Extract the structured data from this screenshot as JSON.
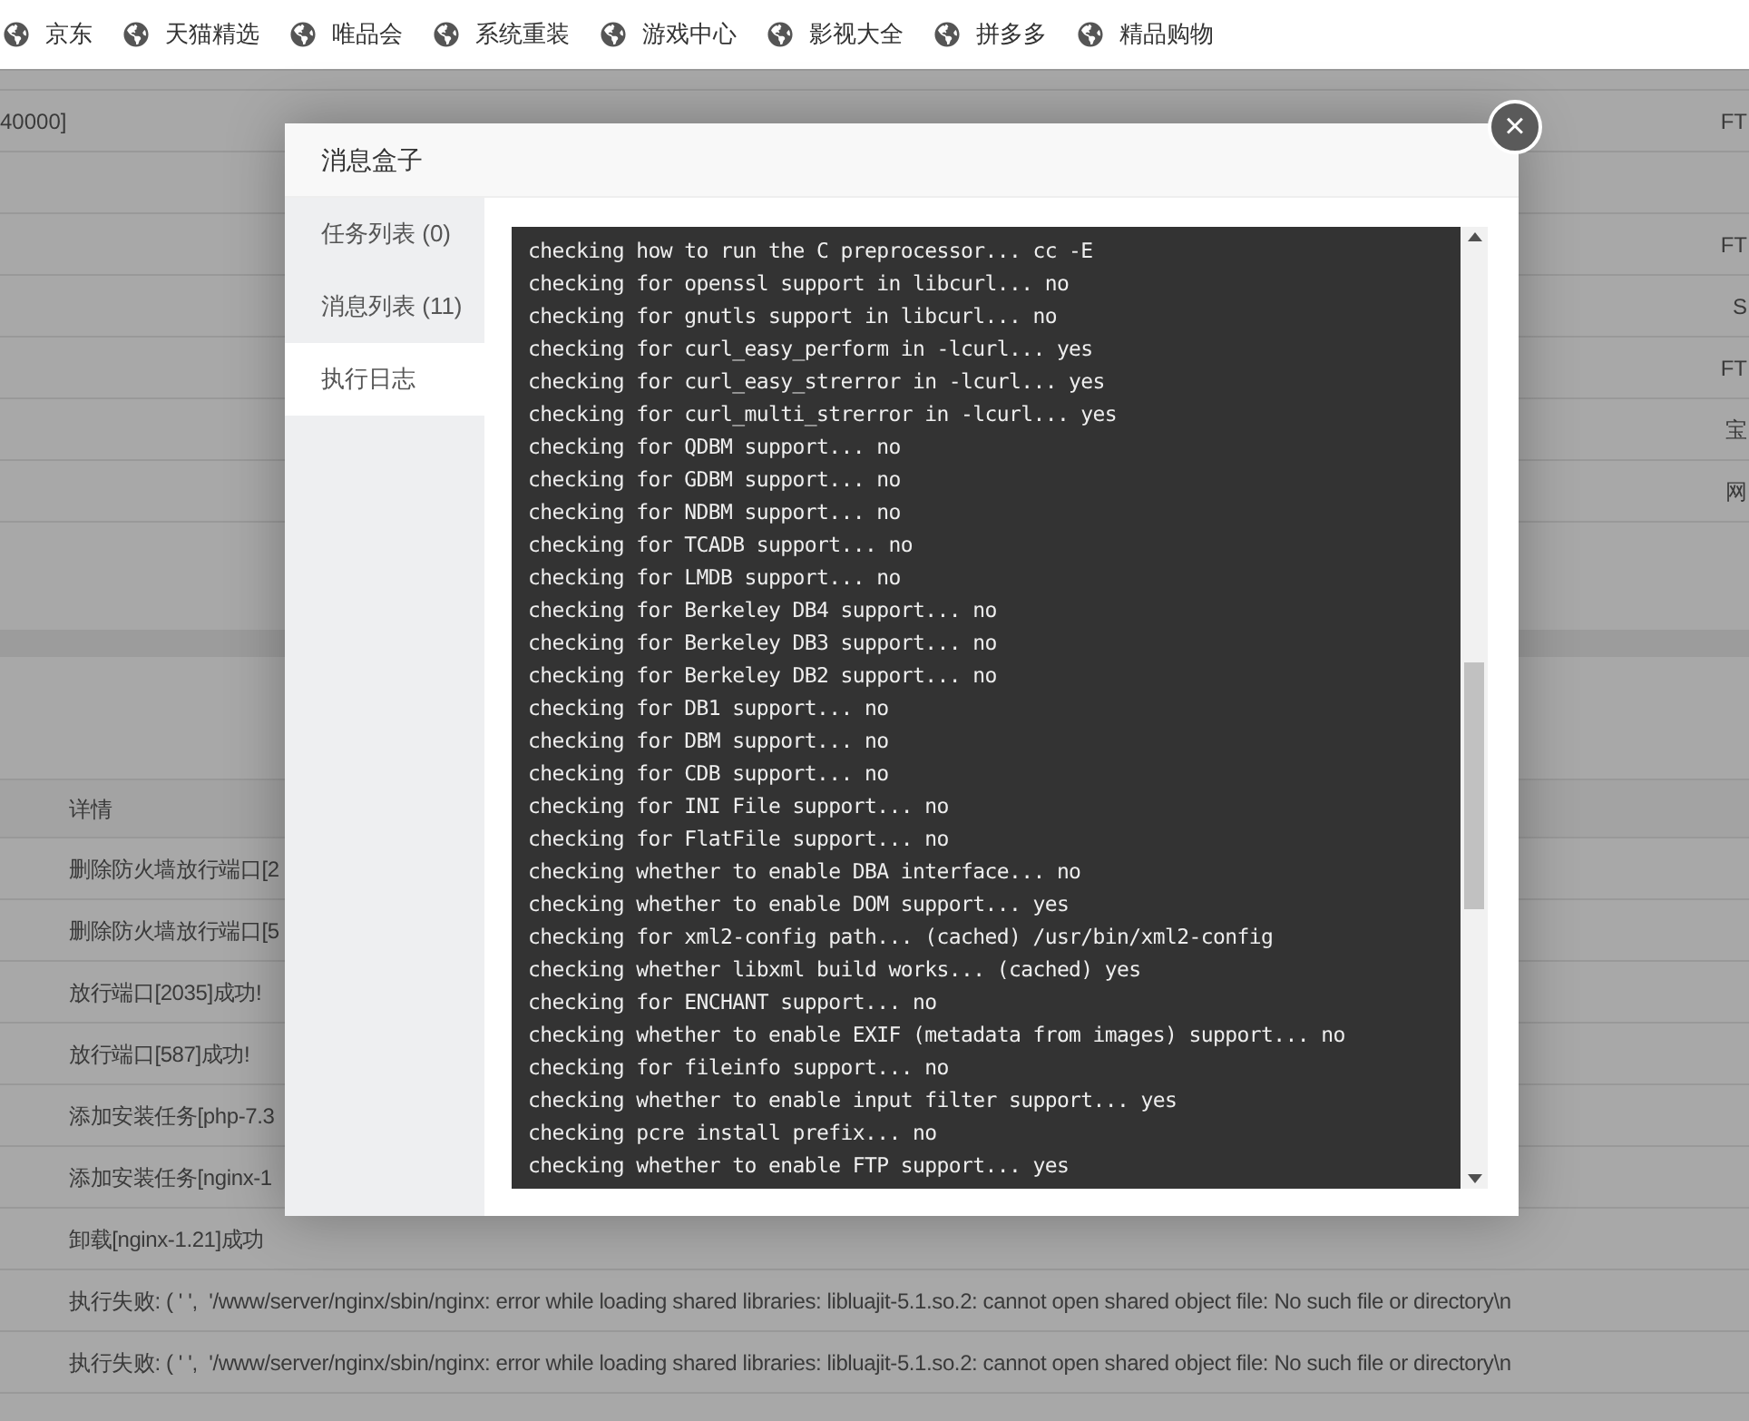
{
  "bookmarks": [
    "京东",
    "天猫精选",
    "唯品会",
    "系统重装",
    "游戏中心",
    "影视大全",
    "拼多多",
    "精品购物"
  ],
  "background": {
    "top_rows": [
      {
        "left": "",
        "right": ""
      },
      {
        "left": "40000]",
        "right": "FT"
      },
      {
        "left": "",
        "right": ""
      },
      {
        "left": "",
        "right": "FT"
      },
      {
        "left": "",
        "right": "S"
      },
      {
        "left": "",
        "right": "FT"
      },
      {
        "left": "",
        "right": "宝"
      },
      {
        "left": "",
        "right": "网"
      }
    ],
    "log_table": {
      "header": "详情",
      "rows": [
        "删除防火墙放行端口[2",
        "删除防火墙放行端口[5",
        "放行端口[2035]成功!",
        "放行端口[587]成功!",
        "添加安装任务[php-7.3",
        "添加安装任务[nginx-1",
        "卸载[nginx-1.21]成功",
        "执行失败: ( ' ',  '/www/server/nginx/sbin/nginx: error while loading shared libraries: libluajit-5.1.so.2: cannot open shared object file: No such file or directory\\n",
        "执行失败: ( ' ',  '/www/server/nginx/sbin/nginx: error while loading shared libraries: libluajit-5.1.so.2: cannot open shared object file: No such file or directory\\n"
      ]
    }
  },
  "modal": {
    "title": "消息盒子",
    "close_symbol": "×",
    "tabs": [
      {
        "label": "任务列表 (0)",
        "selected": false
      },
      {
        "label": "消息列表 (11)",
        "selected": false
      },
      {
        "label": "执行日志",
        "selected": true
      }
    ],
    "log_lines": [
      "checking how to run the C preprocessor... cc -E",
      "checking for openssl support in libcurl... no",
      "checking for gnutls support in libcurl... no",
      "checking for curl_easy_perform in -lcurl... yes",
      "checking for curl_easy_strerror in -lcurl... yes",
      "checking for curl_multi_strerror in -lcurl... yes",
      "checking for QDBM support... no",
      "checking for GDBM support... no",
      "checking for NDBM support... no",
      "checking for TCADB support... no",
      "checking for LMDB support... no",
      "checking for Berkeley DB4 support... no",
      "checking for Berkeley DB3 support... no",
      "checking for Berkeley DB2 support... no",
      "checking for DB1 support... no",
      "checking for DBM support... no",
      "checking for CDB support... no",
      "checking for INI File support... no",
      "checking for FlatFile support... no",
      "checking whether to enable DBA interface... no",
      "checking whether to enable DOM support... yes",
      "checking for xml2-config path... (cached) /usr/bin/xml2-config",
      "checking whether libxml build works... (cached) yes",
      "checking for ENCHANT support... no",
      "checking whether to enable EXIF (metadata from images) support... no",
      "checking for fileinfo support... no",
      "checking whether to enable input filter support... yes",
      "checking pcre install prefix... no",
      "checking whether to enable FTP support... yes"
    ]
  }
}
